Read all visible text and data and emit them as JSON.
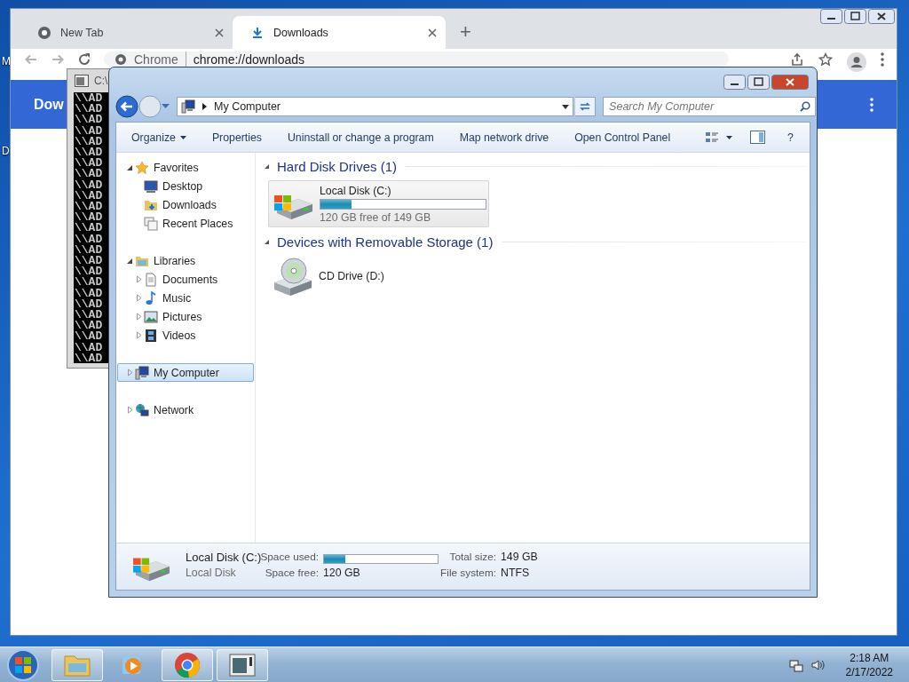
{
  "desktop_icons": [
    {
      "label": "M"
    },
    {
      "label": "D"
    }
  ],
  "browser": {
    "tabs": [
      {
        "label": "New Tab",
        "selected": false
      },
      {
        "label": "Downloads",
        "selected": true
      }
    ],
    "new_tab": "+",
    "omnibox": {
      "site": "Chrome",
      "url": "chrome://downloads"
    },
    "header": {
      "title": "Dow"
    }
  },
  "console": {
    "title": "C:\\",
    "lines": [
      "\\\\AD",
      "\\\\AD",
      "\\\\AD",
      "\\\\AD",
      "\\\\AD",
      "\\\\AD",
      "\\\\AD",
      "\\\\AD",
      "\\\\AD",
      "\\\\AD",
      "\\\\AD",
      "\\\\AD",
      "\\\\AD",
      "\\\\AD",
      "\\\\AD",
      "\\\\AD",
      "\\\\AD",
      "\\\\AD",
      "\\\\AD",
      "\\\\AD",
      "\\\\AD",
      "\\\\AD",
      "\\\\AD",
      "\\\\AD",
      "\\\\AD"
    ]
  },
  "explorer": {
    "address": "My Computer",
    "search": {
      "placeholder": "Search My Computer"
    },
    "commands": [
      {
        "label": "Organize",
        "menu": true
      },
      {
        "label": "Properties",
        "menu": false
      },
      {
        "label": "Uninstall or change a program",
        "menu": false
      },
      {
        "label": "Map network drive",
        "menu": false
      },
      {
        "label": "Open Control Panel",
        "menu": false
      }
    ],
    "help": "?",
    "nav": [
      {
        "label": "Favorites",
        "kind": "favorites",
        "expanded": true,
        "selected": false,
        "children": [
          {
            "label": "Desktop",
            "kind": "desktop",
            "selected": false
          },
          {
            "label": "Downloads",
            "kind": "downloads",
            "selected": false
          },
          {
            "label": "Recent Places",
            "kind": "recent",
            "selected": false
          }
        ]
      },
      {
        "label": "Libraries",
        "kind": "libraries",
        "expanded": true,
        "selected": false,
        "children": [
          {
            "label": "Documents",
            "kind": "documents",
            "expanded": false,
            "selected": false
          },
          {
            "label": "Music",
            "kind": "music",
            "expanded": false,
            "selected": false
          },
          {
            "label": "Pictures",
            "kind": "pictures",
            "expanded": false,
            "selected": false
          },
          {
            "label": "Videos",
            "kind": "videos",
            "expanded": false,
            "selected": false
          }
        ]
      },
      {
        "label": "My Computer",
        "kind": "computer",
        "expanded": false,
        "selected": true
      },
      {
        "label": "Network",
        "kind": "network",
        "expanded": false,
        "selected": false
      }
    ],
    "groups": [
      {
        "title": "Hard Disk Drives (1)",
        "items": [
          {
            "kind": "disk",
            "name": "Local Disk (C:)",
            "level": 0.19,
            "info": "120 GB free of 149 GB"
          }
        ]
      },
      {
        "title": "Devices with Removable Storage (1)",
        "items": [
          {
            "kind": "optical",
            "name": "CD Drive (D:)"
          }
        ]
      }
    ],
    "details": {
      "name": "Local Disk (C:)",
      "type": "Local Disk",
      "used_label": "Space used:",
      "level": 0.19,
      "free_label": "Space free:",
      "free": "120 GB",
      "total_label": "Total size:",
      "total": "149 GB",
      "fs_label": "File system:",
      "fs": "NTFS"
    }
  },
  "taskbar": {
    "apps": [
      {
        "kind": "explorer",
        "open": true
      },
      {
        "kind": "media",
        "open": false
      },
      {
        "kind": "browser",
        "open": true
      },
      {
        "kind": "console",
        "open": true
      }
    ],
    "clock": {
      "time": "2:18 AM",
      "date": "2/17/2022"
    }
  }
}
